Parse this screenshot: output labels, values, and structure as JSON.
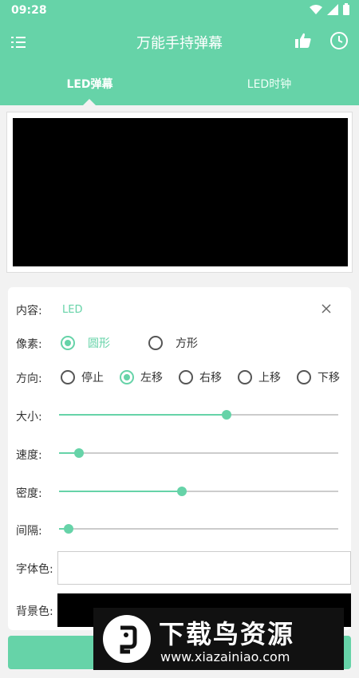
{
  "status_bar": {
    "time": "09:28"
  },
  "app_bar": {
    "title": "万能手持弹幕"
  },
  "tabs": [
    {
      "label": "LED弹幕",
      "selected": true
    },
    {
      "label": "LED时钟",
      "selected": false
    }
  ],
  "settings": {
    "content": {
      "label": "内容:",
      "value": "LED"
    },
    "pixel": {
      "label": "像素:",
      "options": [
        "圆形",
        "方形"
      ],
      "selected": "圆形"
    },
    "direction": {
      "label": "方向:",
      "options": [
        "停止",
        "左移",
        "右移",
        "上移",
        "下移"
      ],
      "selected": "左移"
    },
    "size": {
      "label": "大小:",
      "value": 0.6
    },
    "speed": {
      "label": "速度:",
      "value": 0.07
    },
    "density": {
      "label": "密度:",
      "value": 0.44
    },
    "spacing": {
      "label": "间隔:",
      "value": 0.035
    },
    "font_color": {
      "label": "字体色:",
      "value": "#ffffff"
    },
    "bg_color": {
      "label": "背景色:",
      "value": "#000000"
    }
  },
  "colors": {
    "accent": "#66d3a8",
    "led_background": "#000000"
  },
  "watermark": {
    "brand": "下载鸟资源",
    "url": "www.xiazainiao.com"
  }
}
